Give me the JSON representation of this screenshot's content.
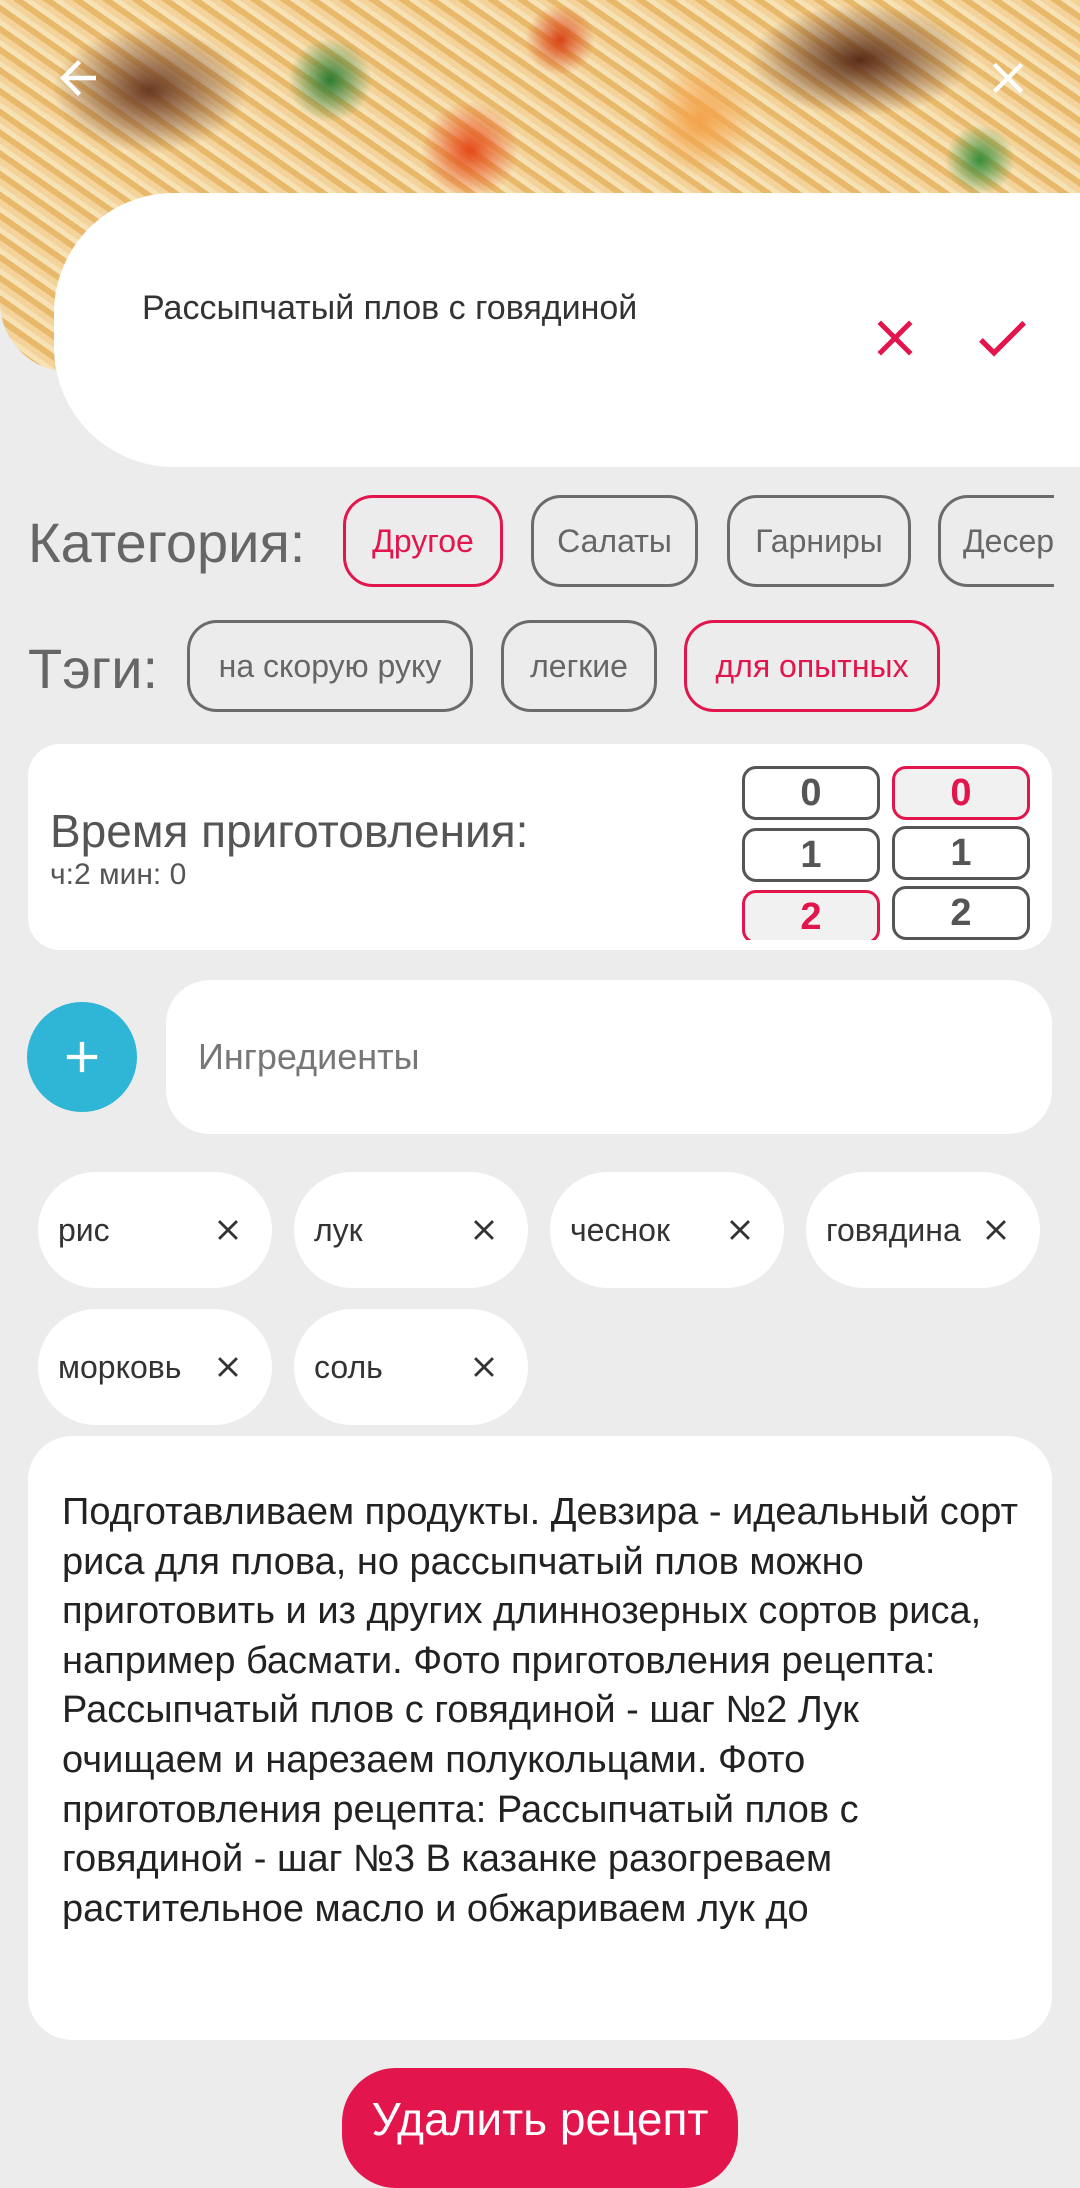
{
  "header": {
    "back_icon": "arrow-left-icon",
    "close_icon": "close-icon"
  },
  "title": {
    "value": "Рассыпчатый плов с говядиной",
    "cancel_icon": "close-icon",
    "confirm_icon": "check-icon"
  },
  "category": {
    "label": "Категория:",
    "options": [
      {
        "label": "Другое",
        "selected": true
      },
      {
        "label": "Салаты",
        "selected": false
      },
      {
        "label": "Гарниры",
        "selected": false
      },
      {
        "label": "Десерты",
        "selected": false
      }
    ]
  },
  "tags": {
    "label": "Тэги:",
    "options": [
      {
        "label": "на скорую руку",
        "selected": false
      },
      {
        "label": "легкие",
        "selected": false
      },
      {
        "label": "для опытных",
        "selected": true
      }
    ]
  },
  "cook_time": {
    "title": "Время приготовления:",
    "summary": "ч:2 мин: 0",
    "hours_options": [
      "0",
      "1",
      "2"
    ],
    "hours_selected": "2",
    "minutes_options": [
      "0",
      "1",
      "2"
    ],
    "minutes_selected": "0"
  },
  "ingredients": {
    "add_icon": "plus-icon",
    "placeholder": "Ингредиенты",
    "items": [
      "рис",
      "лук",
      "чеснок",
      "говядина",
      "морковь",
      "соль"
    ]
  },
  "description": "Подготавливаем продукты. Девзира - идеальный сорт риса для плова, но рассыпчатый плов можно приготовить и из других длиннозерных сортов риса, например басмати.  Фото приготовления рецепта: Рассыпчатый плов с говядиной - шаг №2 Лук очищаем и нарезаем полукольцами.  Фото приготовления рецепта: Рассыпчатый плов с говядиной - шаг №3 В казанке разогреваем растительное масло и обжариваем лук до",
  "delete_label": "Удалить рецепт",
  "colors": {
    "accent": "#e3154d",
    "add_button": "#2fb5d6",
    "background": "#ececec"
  }
}
